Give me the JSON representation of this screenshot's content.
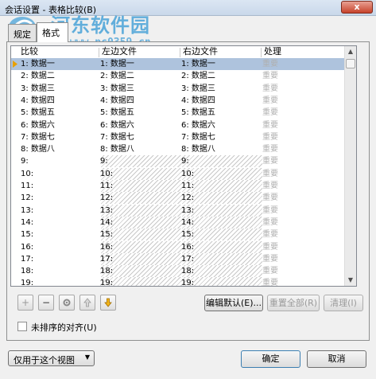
{
  "window": {
    "title": "会话设置 - 表格比较(B)",
    "close_glyph": "x"
  },
  "watermark": {
    "name": "河东软件园",
    "url": "www.pc0359.cn"
  },
  "tabs": [
    {
      "label": "规定",
      "active": false
    },
    {
      "label": "格式",
      "active": true
    }
  ],
  "grid": {
    "headers": {
      "compare": "比较",
      "left": "左边文件",
      "right": "右边文件",
      "action": "处理"
    },
    "rows": [
      {
        "num": "1: 数据一",
        "left": "1: 数据一",
        "right": "1: 数据一",
        "action": "重要",
        "selected": true
      },
      {
        "num": "2: 数据二",
        "left": "2: 数据二",
        "right": "2: 数据二",
        "action": "重要"
      },
      {
        "num": "3: 数据三",
        "left": "3: 数据三",
        "right": "3: 数据三",
        "action": "重要"
      },
      {
        "num": "4: 数据四",
        "left": "4: 数据四",
        "right": "4: 数据四",
        "action": "重要"
      },
      {
        "num": "5: 数据五",
        "left": "5: 数据五",
        "right": "5: 数据五",
        "action": "重要"
      },
      {
        "num": "6: 数据六",
        "left": "6: 数据六",
        "right": "6: 数据六",
        "action": "重要"
      },
      {
        "num": "7: 数据七",
        "left": "7: 数据七",
        "right": "7: 数据七",
        "action": "重要"
      },
      {
        "num": "8: 数据八",
        "left": "8: 数据八",
        "right": "8: 数据八",
        "action": "重要"
      },
      {
        "num": "9:",
        "left": "9:",
        "right": "9:",
        "action": "重要"
      },
      {
        "num": "10:",
        "left": "10:",
        "right": "10:",
        "action": "重要"
      },
      {
        "num": "11:",
        "left": "11:",
        "right": "11:",
        "action": "重要"
      },
      {
        "num": "12:",
        "left": "12:",
        "right": "12:",
        "action": "重要"
      },
      {
        "num": "13:",
        "left": "13:",
        "right": "13:",
        "action": "重要"
      },
      {
        "num": "14:",
        "left": "14:",
        "right": "14:",
        "action": "重要"
      },
      {
        "num": "15:",
        "left": "15:",
        "right": "15:",
        "action": "重要"
      },
      {
        "num": "16:",
        "left": "16:",
        "right": "16:",
        "action": "重要"
      },
      {
        "num": "17:",
        "left": "17:",
        "right": "17:",
        "action": "重要"
      },
      {
        "num": "18:",
        "left": "18:",
        "right": "18:",
        "action": "重要"
      },
      {
        "num": "19:",
        "left": "19:",
        "right": "19:",
        "action": "重要"
      }
    ]
  },
  "toolbar": {
    "add": "+",
    "remove": "−",
    "settings_icon": "gear-icon",
    "up_icon": "arrow-up-icon",
    "down_icon": "arrow-down-icon",
    "edit_default": "编辑默认(E)...",
    "reset_all": "重置全部(R)",
    "clear": "清理(I)"
  },
  "options": {
    "unsorted_align": "未排序的对齐(U)",
    "unsorted_align_checked": false
  },
  "footer": {
    "scope_selected": "仅用于这个视图",
    "ok": "确定",
    "cancel": "取消"
  },
  "colors": {
    "accent_watermark": "#4aa3d8",
    "selection": "#aec3dd",
    "down_arrow": "#e8a000"
  }
}
